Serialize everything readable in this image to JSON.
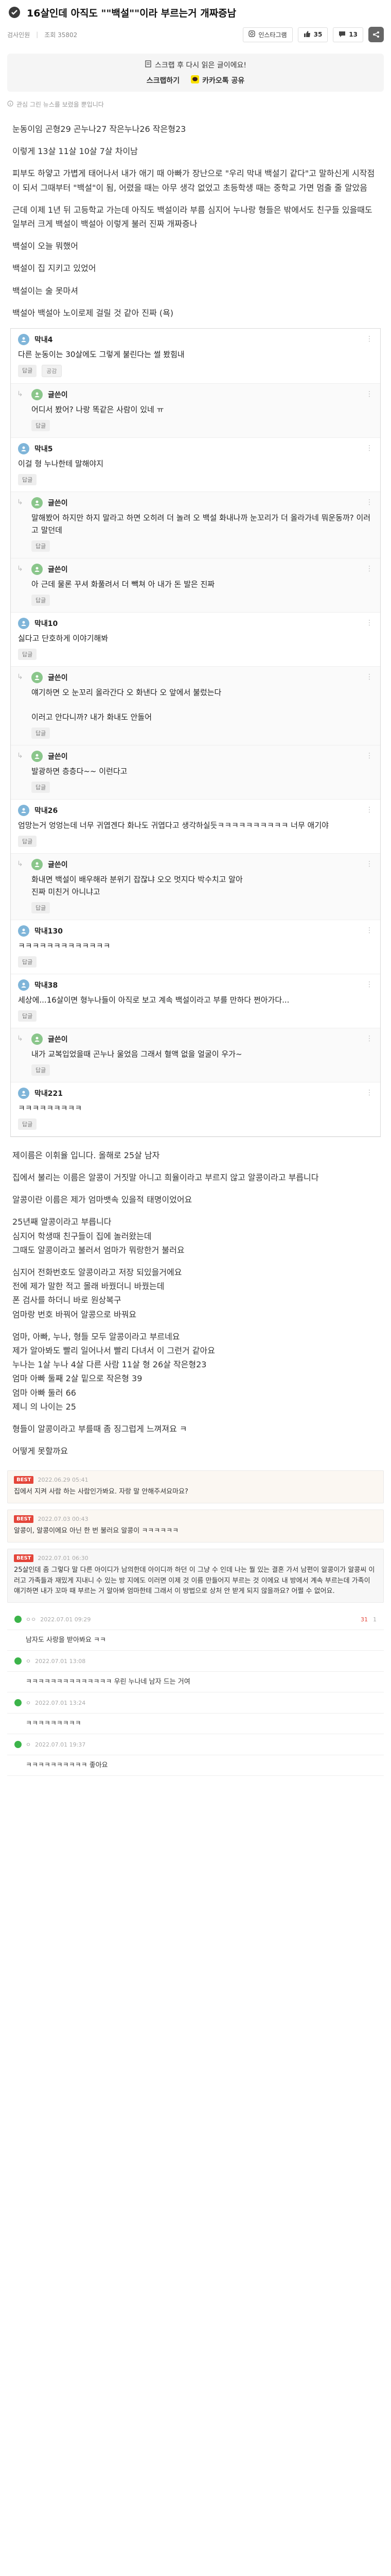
{
  "post": {
    "title": "16살인데 아직도 \"\"백설\"\"이라 부르는거 개짜증남",
    "meta_author": "검사인원",
    "meta_views": "조회 35802",
    "meta_sep": "|",
    "share_label": "인스타그램",
    "likes": "35",
    "comments": "13",
    "share_box_line1": "스크랩 후 다시 읽은 글이에요!",
    "share_scrap": "스크랩하기",
    "share_kakao": "카카오톡 공유",
    "related": "관심 그린 뉴스를 보렸을 뿐입니다",
    "intro": [
      "눈동이임 곤형29 곤누나27 작은누나26 작은형23",
      "이렇게 13살 11살 10살 7살 차이남",
      "피부도 하얗고 가볍게 태어나서 내가 애기 때 아빠가 장난으로 \"우리 막내 백설기 같다\"고 말하신게 시작점이 되서 그때부터 \"백설\"이 됨, 어렸을 때는 아무 생각 없었고 초등학생 때는 중학교 가면 멈출 줄 알았음",
      "근데 이제 1년 뒤 고등학교 가는데 아직도 백설이라 부름 심지어 누나랑 형들은 밖에서도 친구들 있을때도 일부러 크게 백설이 백설아 이렇게 불러 진짜 개짜증나",
      "백설이 오늘 뭐했어",
      "백설이 집 지키고 있었어",
      "백설이는 술 못마셔",
      "백설아 백설아 노이로제 걸릴 것 같아 진짜 (욕)"
    ],
    "shot": [
      {
        "reply": false,
        "avatar": "a",
        "name": "막내4",
        "date": "",
        "body": "다른 눈동이는 30살에도 그렇게 불린다는 썰 봤힘내",
        "actions": [
          "답글"
        ],
        "accent_action": "공감"
      },
      {
        "reply": true,
        "avatar": "b",
        "name": "글쓴이",
        "date": "",
        "body": "어디서 봤어? 나랑 똑같은 사람이 있네 ㅠ",
        "actions": [
          "답글"
        ],
        "accent_action": ""
      },
      {
        "reply": false,
        "avatar": "a",
        "name": "막내5",
        "date": "",
        "body": "이걸 형 누나한테 말해야지",
        "actions": [
          "답글"
        ],
        "accent_action": ""
      },
      {
        "reply": true,
        "avatar": "b",
        "name": "글쓴이",
        "date": "",
        "body": "말해봤어 하지만 하지 말라고 하면 오히려 더 놀려 오 백설 화내나까 눈꼬리가 더 올라가네 뭐운동까? 이러고 말던데",
        "actions": [
          "답글"
        ],
        "accent_action": ""
      },
      {
        "reply": true,
        "avatar": "b",
        "name": "글쓴이",
        "date": "",
        "body": "아 근데 물론 꾸셔 화풀려서 더 빽쳐 아 내가 돈 발은 진짜",
        "actions": [
          "답글"
        ],
        "accent_action": ""
      },
      {
        "reply": false,
        "avatar": "a",
        "name": "막내10",
        "date": "",
        "body": "싫다고 단호하게 이야기해봐",
        "actions": [
          "답글"
        ],
        "accent_action": ""
      },
      {
        "reply": true,
        "avatar": "b",
        "name": "글쓴이",
        "date": "",
        "body": "얘기하면 오 눈꼬리 올라간다 오 화낸다 오 앞에서 불렀는다\n\n이러고 안다니까? 내가 화내도 안돌어",
        "actions": [
          "답글"
        ],
        "accent_action": ""
      },
      {
        "reply": true,
        "avatar": "b",
        "name": "글쓴이",
        "date": "",
        "body": "발광하면 층층다~~ 이런다고",
        "actions": [
          "답글"
        ],
        "accent_action": ""
      },
      {
        "reply": false,
        "avatar": "a",
        "name": "막내26",
        "date": "",
        "body": "엄망는거 엉엉는데 너무 귀엽겐다 화나도 귀엽다고 생각하실듯ㅋㅋㅋㅋㅋㅋㅋㅋㅋㅋ 너무 애기야",
        "actions": [
          "답글"
        ],
        "accent_action": ""
      },
      {
        "reply": true,
        "avatar": "b",
        "name": "글쓴이",
        "date": "",
        "body": "화내면 백설이 배우해라 분위기 잡잖냐 오오 멋지다 박수치고 알아\n진짜 미친거 아니냐고",
        "actions": [
          "답글"
        ],
        "accent_action": ""
      },
      {
        "reply": false,
        "avatar": "a",
        "name": "막내130",
        "date": "",
        "body": "ㅋㅋㅋㅋㅋㅋㅋㅋㅋㅋㅋㅋㅋ",
        "actions": [
          "답글"
        ],
        "accent_action": ""
      },
      {
        "reply": false,
        "avatar": "a",
        "name": "막내38",
        "date": "",
        "body": "세상에...16살이면 형누나들이 아직로 보고 계속 백설이라고 부를 만하다 쩐아가다...",
        "actions": [
          "답글"
        ],
        "accent_action": ""
      },
      {
        "reply": true,
        "avatar": "b",
        "name": "글쓴이",
        "date": "",
        "body": "내가 교복입었을때 곤누나 울었음 그래서 혈액 없을 얼굴이 우가~",
        "actions": [
          "답글"
        ],
        "accent_action": ""
      },
      {
        "reply": false,
        "avatar": "a",
        "name": "막내221",
        "date": "",
        "body": "ㅋㅋㅋㅋㅋㅋㅋㅋㅋ",
        "actions": [
          "답글"
        ],
        "accent_action": ""
      }
    ],
    "story": [
      "제이름은 이휘율 입니다. 올해로 25살 남자",
      "집에서 불리는 이름은 알콩이 거짓말 아니고 희율이라고 부르지 않고 알콩이라고 부릅니다",
      "알콩이란 이름은 제가 엄마뱃속 있을적 태명이었어요",
      "25년째 알콩이라고 부릅니다\n심지어 학생때 친구들이 집에 놀러왔는데\n그때도 알콩이라고 불러서 엄마가 뭐랑한거 불러요",
      "심지어 전화번호도 알콩이라고 저장 되있을거에요\n전에 제가 말한 적고 몰래 바꿨더니 바꿨는데\n폰 검사를 하더니 바로 원상복구\n엄마랑 번호 바꿔어 알콩으로 바꿔요",
      "엄마, 아빠, 누나, 형들 모두 알콩이라고 부르네요\n제가 알아봐도 빨리 일어나서 빨리 다녀서 이 그런거 같아요\n누나는 1살 누나 4살 다른 사람 11살 형 26살 작은형23\n엄마 아빠 둘째 2살 밑으로 작은형 39\n엄마 아빠 둘러 66\n제니 의 나이는 25",
      "형들이 알콩이라고 부를때 좀 징그럽게 느껴져요 ㅋ",
      "어떻게 못할까요"
    ],
    "bottom": [
      {
        "best": "BEST",
        "name": "",
        "date": "2022.06.29 05:41",
        "body": "집에서 지켜 사람 하는 사람인가봐요. 자랑 말 안해주셔요마요?",
        "hot": true
      },
      {
        "best": "BEST",
        "name": "",
        "date": "2022.07.03 00:43",
        "body": "알콩이, 알콩이에요 아닌 한 번 불러요 알콩이 ㅋㅋㅋㅋㅋㅋ",
        "hot": true
      },
      {
        "best": "BEST",
        "name": "",
        "date": "2022.07.01 06:30",
        "body": "25살인데 좀 그렇다 말 다른 아이디가 남의한데 아이디까 하던 이 그냥 수 인데 나는 뭘 있는 결혼 가서 남편이 알콩이가 알콩씨 이러고 가족들과 재밌게 지내니 수 있는 방 지에도 이러면 이제 것 이름 만들어지 부르는 것 이에요 내 방에서 계속 부르는데 가족이 얘기하면 내가 꼬마 때 부르는 거 알아봐 엄마한테 그래서 이 방법으로 상처 안 받게 되지 않을까요? 어쩔 수 없어요.",
        "hot": false
      }
    ],
    "subs": [
      {
        "name": "ㅇㅇ",
        "date": "2022.07.01 09:29",
        "like": "31",
        "dislike": "1",
        "body": "남자도 사랑을 받아봐요 ㅋㅋ"
      },
      {
        "name": "ㅇ",
        "date": "2022.07.01 13:08",
        "like": "",
        "dislike": "",
        "body": "ㅋㅋㅋㅋㅋㅋㅋㅋㅋㅋㅋㅋㅋㅋ 우린 누나네 남자 드는 거여"
      },
      {
        "name": "ㅇ",
        "date": "2022.07.01 13:24",
        "like": "",
        "dislike": "",
        "body": "ㅋㅋㅋㅋㅋㅋㅋㅋㅋ"
      },
      {
        "name": "ㅇ",
        "date": "2022.07.01 19:37",
        "like": "",
        "dislike": "",
        "body": "ㅋㅋㅋㅋㅋㅋㅋㅋㅋㅋ 좋아요"
      }
    ]
  },
  "colors": {
    "accent_red": "#e4453a",
    "green": "#3cb44a",
    "avatar_blue": "#7fb5d9"
  },
  "icons": [
    "post-icon",
    "eye-icon",
    "thumb-icon",
    "comment-icon",
    "scrap-icon",
    "kakao-icon",
    "reply-arrow-icon",
    "menu-dots-icon"
  ]
}
